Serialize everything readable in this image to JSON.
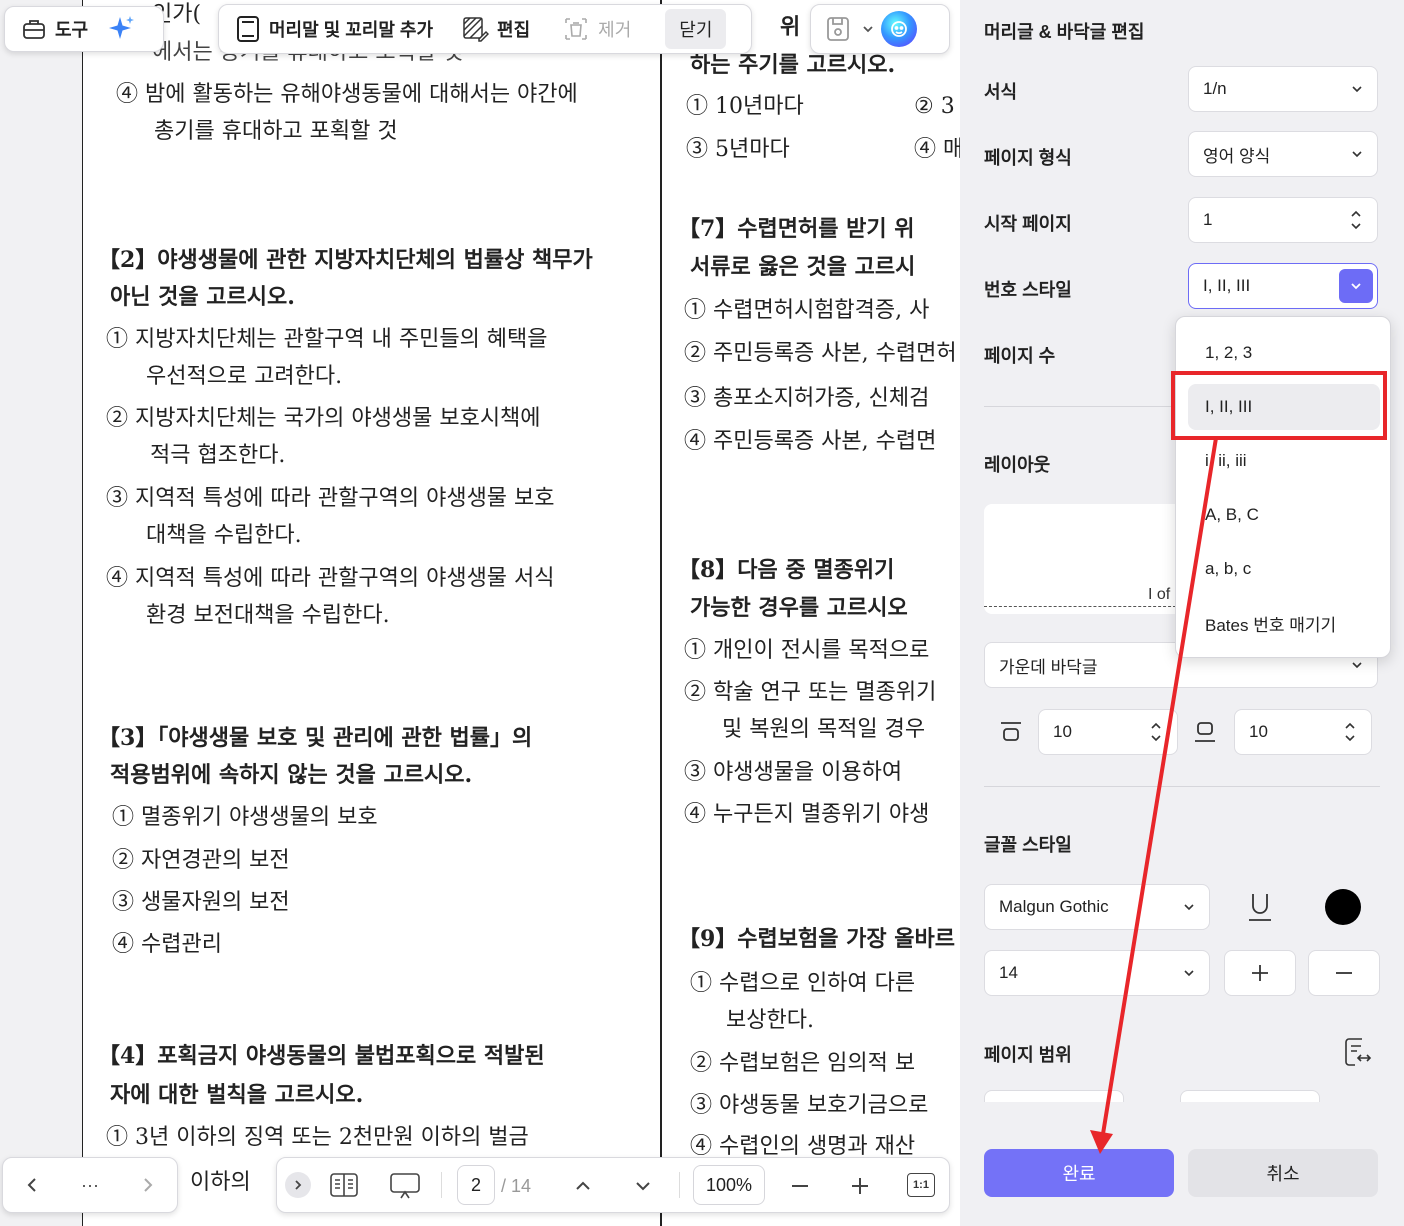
{
  "toolbar_left": {
    "tools_label": "도구"
  },
  "toolbar_main": {
    "header_footer_label": "머리말 및 꼬리말 추가",
    "edit_label": "편집",
    "remove_label": "제거",
    "close_label": "닫기"
  },
  "document": {
    "left_column": [
      {
        "text": "인가(",
        "bold": false
      },
      {
        "text": "에서는 중거를 휴대하고 포획할 것",
        "bold": false
      },
      {
        "text": "④ 밤에 활동하는 유해야생동물에 대해서는 야간에",
        "bold": false
      },
      {
        "text": "총기를 휴대하고 포획할 것",
        "bold": false
      },
      {
        "text": "【2】야생생물에 관한 지방자치단체의 법률상 책무가",
        "bold": true
      },
      {
        "text": "아닌 것을 고르시오.",
        "bold": true
      },
      {
        "text": "① 지방자치단체는 관할구역 내 주민들의 혜택을",
        "bold": false
      },
      {
        "text": "우선적으로 고려한다.",
        "bold": false
      },
      {
        "text": "② 지방자치단체는 국가의 야생생물 보호시책에",
        "bold": false
      },
      {
        "text": "적극 협조한다.",
        "bold": false
      },
      {
        "text": "③ 지역적 특성에 따라 관할구역의 야생생물 보호",
        "bold": false
      },
      {
        "text": "대책을 수립한다.",
        "bold": false
      },
      {
        "text": "④ 지역적 특성에 따라 관할구역의 야생생물 서식",
        "bold": false
      },
      {
        "text": "환경 보전대책을 수립한다.",
        "bold": false
      },
      {
        "text": "【3】「야생생물 보호 및 관리에 관한 법률」의",
        "bold": true
      },
      {
        "text": "적용범위에 속하지 않는 것을 고르시오.",
        "bold": true
      },
      {
        "text": "① 멸종위기 야생생물의 보호",
        "bold": false
      },
      {
        "text": "② 자연경관의 보전",
        "bold": false
      },
      {
        "text": "③ 생물자원의 보전",
        "bold": false
      },
      {
        "text": "④ 수렵관리",
        "bold": false
      },
      {
        "text": "【4】포획금지 야생동물의 불법포획으로 적발된",
        "bold": true
      },
      {
        "text": "자에 대한 벌칙을 고르시오.",
        "bold": true
      },
      {
        "text": "① 3년 이하의 징역 또는 2천만원 이하의 벌금",
        "bold": false
      },
      {
        "text": "이하의",
        "bold": false
      }
    ],
    "right_column": [
      {
        "text": "위",
        "bold": true
      },
      {
        "text": "하는 주기를 고르시오.",
        "bold": true
      },
      {
        "text": "① 10년마다",
        "bold": false
      },
      {
        "text": "② 3",
        "bold": false
      },
      {
        "text": "③ 5년마다",
        "bold": false
      },
      {
        "text": "④ 매",
        "bold": false
      },
      {
        "text": "【7】수렵면허를 받기 위",
        "bold": true
      },
      {
        "text": "서류로 옳은 것을 고르시",
        "bold": true
      },
      {
        "text": "① 수렵면허시험합격증, 사",
        "bold": false
      },
      {
        "text": "② 주민등록증 사본, 수렵면허",
        "bold": false
      },
      {
        "text": "③ 총포소지허가증, 신체검",
        "bold": false
      },
      {
        "text": "④ 주민등록증 사본, 수렵면",
        "bold": false
      },
      {
        "text": "【8】다음 중 멸종위기",
        "bold": true
      },
      {
        "text": "가능한 경우를 고르시오",
        "bold": true
      },
      {
        "text": "① 개인이 전시를 목적으로",
        "bold": false
      },
      {
        "text": "② 학술 연구 또는 멸종위기",
        "bold": false
      },
      {
        "text": "및 복원의 목적일 경우",
        "bold": false
      },
      {
        "text": "③ 야생생물을 이용하여",
        "bold": false
      },
      {
        "text": "④ 누구든지 멸종위기 야생",
        "bold": false
      },
      {
        "text": "【9】수렵보험을 가장 올바르",
        "bold": true
      },
      {
        "text": "① 수렵으로 인하여 다른",
        "bold": false
      },
      {
        "text": "보상한다.",
        "bold": false
      },
      {
        "text": "② 수렵보험은 임의적 보",
        "bold": false
      },
      {
        "text": "③ 야생동물 보호기금으로",
        "bold": false
      },
      {
        "text": "④ 수렵인의 생명과 재산",
        "bold": false
      }
    ]
  },
  "bottom_bar": {
    "ellipsis": "···",
    "current_page": "2",
    "total_pages": "/ 14",
    "zoom": "100%",
    "fit_label": "1:1"
  },
  "panel": {
    "title": "머리글 & 바닥글 편집",
    "format_label": "서식",
    "format_value": "1/n",
    "page_format_label": "페이지 형식",
    "page_format_value": "영어 양식",
    "start_page_label": "시작 페이지",
    "start_page_value": "1",
    "number_style_label": "번호 스타일",
    "number_style_value": "I, II, III",
    "page_count_label": "페이지 수",
    "layout_label": "레이아웃",
    "layout_preview_text": "I of",
    "position_value": "가운데 바닥글",
    "top_margin": "10",
    "bottom_margin": "10",
    "font_style_label": "글꼴 스타일",
    "font_family_value": "Malgun Gothic",
    "font_size_value": "14",
    "page_range_label": "페이지 범위",
    "done_label": "완료",
    "cancel_label": "취소",
    "text_color": "#000000",
    "accent_color": "#6d6cf6"
  },
  "number_style_menu": {
    "items": [
      "1, 2, 3",
      "I, II, III",
      "i, ii, iii",
      "A, B, C",
      "a, b, c",
      "Bates 번호 매기기"
    ],
    "selected": "I, II, III"
  },
  "annotation_color": "#e8262a"
}
